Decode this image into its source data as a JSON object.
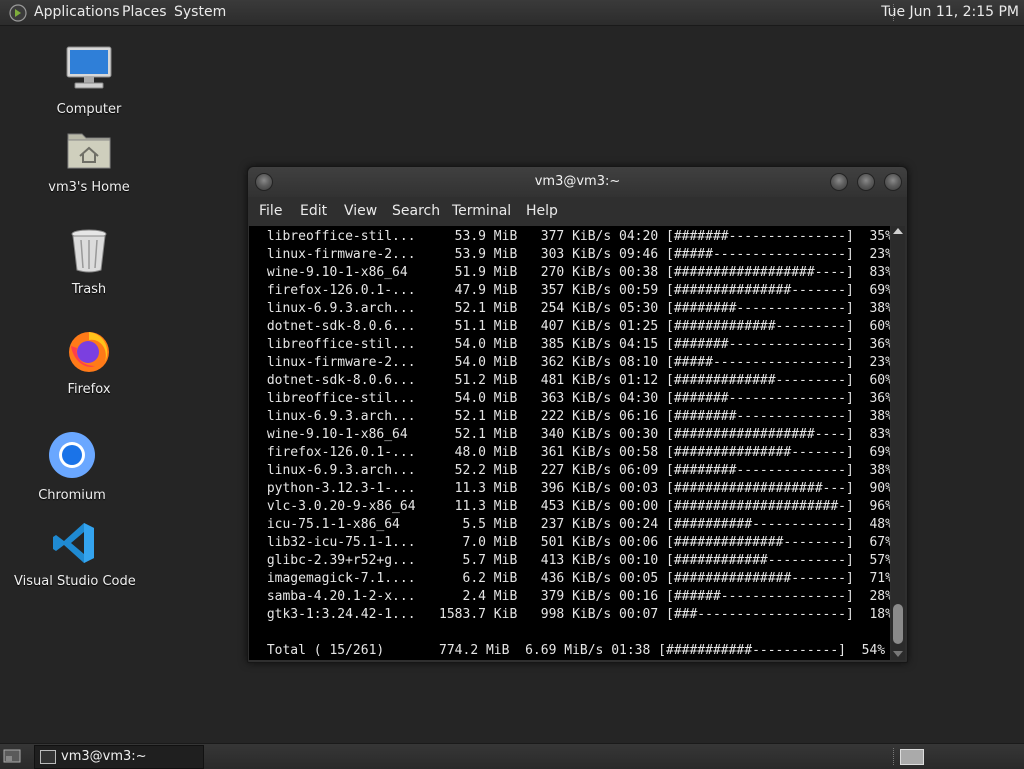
{
  "top_panel": {
    "menus": [
      "Applications",
      "Places",
      "System"
    ],
    "clock": "Tue Jun 11,  2:15 PM"
  },
  "desktop_icons": [
    {
      "label": "Computer",
      "icon": "computer-icon"
    },
    {
      "label": "vm3's Home",
      "icon": "home-folder-icon"
    },
    {
      "label": "Trash",
      "icon": "trash-icon"
    },
    {
      "label": "Firefox",
      "icon": "firefox-icon"
    },
    {
      "label": "Chromium",
      "icon": "chromium-icon"
    },
    {
      "label": "Visual Studio Code",
      "icon": "vscode-icon"
    }
  ],
  "terminal": {
    "title": "vm3@vm3:~",
    "menu": [
      "File",
      "Edit",
      "View",
      "Search",
      "Terminal",
      "Help"
    ],
    "lines": [
      " libreoffice-stil...     53.9 MiB   377 KiB/s 04:20 [#######---------------]  35%",
      " linux-firmware-2...     53.9 MiB   303 KiB/s 09:46 [#####-----------------]  23%",
      " wine-9.10-1-x86_64      51.9 MiB   270 KiB/s 00:38 [##################----]  83%",
      " firefox-126.0.1-...     47.9 MiB   357 KiB/s 00:59 [###############-------]  69%",
      " linux-6.9.3.arch...     52.1 MiB   254 KiB/s 05:30 [########--------------]  38%",
      " dotnet-sdk-8.0.6...     51.1 MiB   407 KiB/s 01:25 [#############---------]  60%",
      " libreoffice-stil...     54.0 MiB   385 KiB/s 04:15 [#######---------------]  36%",
      " linux-firmware-2...     54.0 MiB   362 KiB/s 08:10 [#####-----------------]  23%",
      " dotnet-sdk-8.0.6...     51.2 MiB   481 KiB/s 01:12 [#############---------]  60%",
      " libreoffice-stil...     54.0 MiB   363 KiB/s 04:30 [#######---------------]  36%",
      " linux-6.9.3.arch...     52.1 MiB   222 KiB/s 06:16 [########--------------]  38%",
      " wine-9.10-1-x86_64      52.1 MiB   340 KiB/s 00:30 [##################----]  83%",
      " firefox-126.0.1-...     48.0 MiB   361 KiB/s 00:58 [###############-------]  69%",
      " linux-6.9.3.arch...     52.2 MiB   227 KiB/s 06:09 [########--------------]  38%",
      " python-3.12.3-1-...     11.3 MiB   396 KiB/s 00:03 [###################---]  90%",
      " vlc-3.0.20-9-x86_64     11.3 MiB   453 KiB/s 00:00 [#####################-]  96%",
      " icu-75.1-1-x86_64        5.5 MiB   237 KiB/s 00:24 [##########------------]  48%",
      " lib32-icu-75.1-1...      7.0 MiB   501 KiB/s 00:06 [##############--------]  67%",
      " glibc-2.39+r52+g...      5.7 MiB   413 KiB/s 00:10 [############----------]  57%",
      " imagemagick-7.1....      6.2 MiB   436 KiB/s 00:05 [###############-------]  71%",
      " samba-4.20.1-2-x...      2.4 MiB   379 KiB/s 00:16 [######----------------]  28%",
      " gtk3-1:3.24.42-1...   1583.7 KiB   998 KiB/s 00:07 [###-------------------]  18%",
      "",
      " Total ( 15/261)       774.2 MiB  6.69 MiB/s 01:38 [###########-----------]  54%"
    ]
  },
  "taskbar": {
    "task_label": "vm3@vm3:~"
  }
}
